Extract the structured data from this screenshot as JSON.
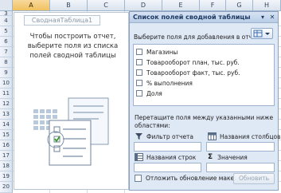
{
  "sheet": {
    "columns": [
      "A",
      "B",
      "C",
      "D",
      "E",
      "F",
      "G",
      "H"
    ],
    "active_column": "A",
    "rows": [
      "3",
      "4",
      "5",
      "6",
      "7",
      "8",
      "9",
      "10",
      "11",
      "12",
      "13",
      "14",
      "15",
      "16",
      "17",
      "18",
      "19",
      "20"
    ]
  },
  "pivot": {
    "name": "СводнаяТаблица1",
    "hint": "Чтобы построить отчет,\nвыберите поля из списка\nполей сводной таблицы"
  },
  "pane": {
    "title": "Список полей сводной таблицы",
    "instruction": "Выберите поля для добавления в отчет:",
    "fields": [
      {
        "label": "Магазины",
        "checked": false
      },
      {
        "label": "Товарооборот план, тыс. руб.",
        "checked": false
      },
      {
        "label": "Товарооборот факт, тыс. руб.",
        "checked": false
      },
      {
        "label": "% выполнения",
        "checked": false
      },
      {
        "label": "Доля",
        "checked": false
      }
    ],
    "drag_instruction": "Перетащите поля между указанными ниже\nобластями:",
    "zones": {
      "report_filter": "Фильтр отчета",
      "column_labels": "Названия столбцов",
      "row_labels": "Названия строк",
      "values": "Значения",
      "sigma": "Σ"
    },
    "defer_label": "Отложить обновление макета",
    "update_button": "Обновить"
  },
  "icons": {
    "dropdown": "chevron-down-icon",
    "close": "close-icon",
    "layout": "layout-icon",
    "filter": "filter-icon",
    "columns": "column-labels-icon",
    "rows": "row-labels-icon"
  },
  "colors": {
    "pane_bg": "#dfe8f5",
    "header_active": "#f1c15f",
    "grid": "#d4dce6"
  }
}
